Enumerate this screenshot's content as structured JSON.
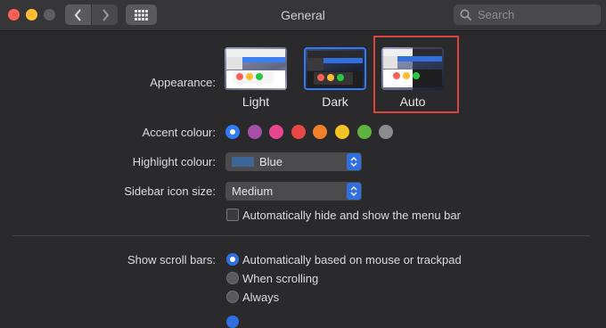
{
  "window": {
    "title": "General"
  },
  "search": {
    "placeholder": "Search"
  },
  "appearance": {
    "label": "Appearance:",
    "options": [
      {
        "label": "Light"
      },
      {
        "label": "Dark"
      },
      {
        "label": "Auto"
      }
    ]
  },
  "accent": {
    "label": "Accent colour:",
    "colors": [
      "#2f7cf6",
      "#a550a7",
      "#e8478f",
      "#e94945",
      "#f1802a",
      "#f5c226",
      "#5fb340",
      "#8c8c8c"
    ],
    "selected_index": 0
  },
  "highlight": {
    "label": "Highlight colour:",
    "value": "Blue",
    "swatch": "#3d6596"
  },
  "sidebar_icon": {
    "label": "Sidebar icon size:",
    "value": "Medium"
  },
  "menubar": {
    "label": "Automatically hide and show the menu bar",
    "checked": false
  },
  "scrollbars": {
    "label": "Show scroll bars:",
    "options": [
      {
        "label": "Automatically based on mouse or trackpad",
        "selected": true
      },
      {
        "label": "When scrolling",
        "selected": false
      },
      {
        "label": "Always",
        "selected": false
      }
    ]
  },
  "colors": {
    "accent": "#2f6fe0",
    "annotation": "#d9453d"
  }
}
